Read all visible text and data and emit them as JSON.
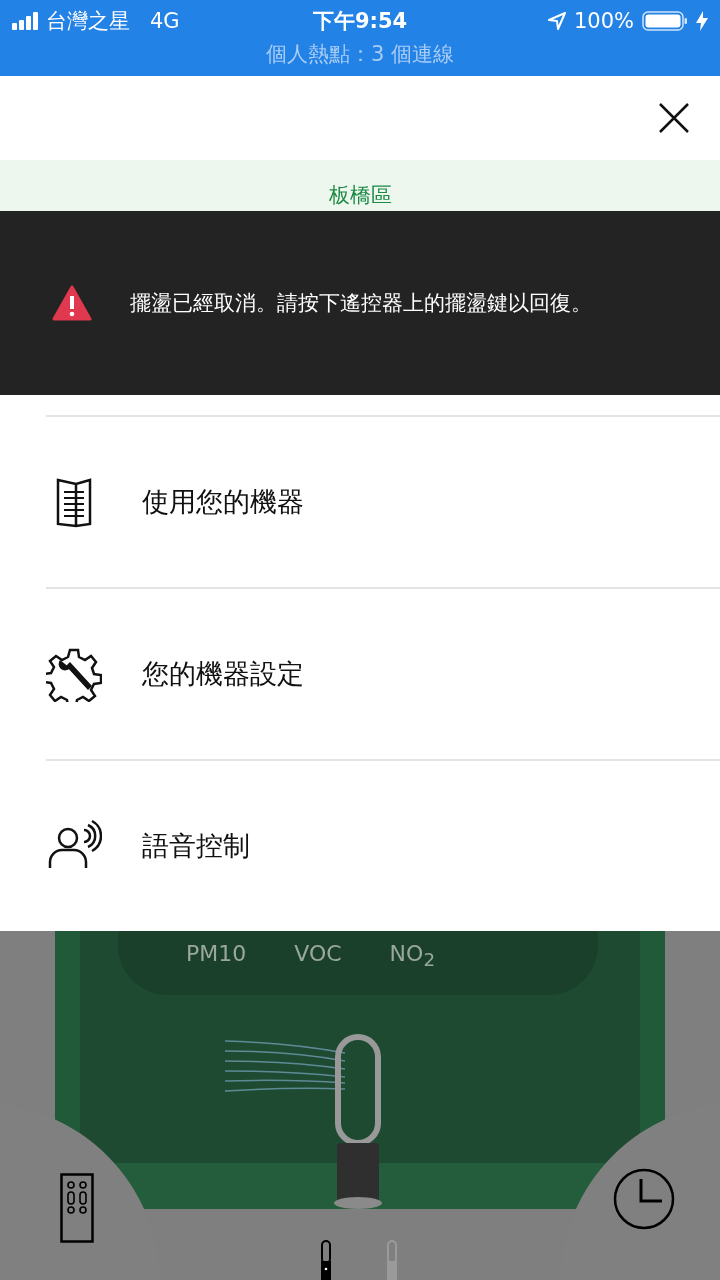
{
  "status_bar": {
    "carrier": "台灣之星",
    "network": "4G",
    "time": "下午9:54",
    "battery": "100%",
    "hotspot": "個人熱點：3 個連線"
  },
  "header": {
    "location": "板橋區"
  },
  "alert": {
    "message": "擺盪已經取消。請按下遙控器上的擺盪鍵以回復。"
  },
  "menu": [
    {
      "kind": "manual",
      "label": "使用您的機器"
    },
    {
      "kind": "settings",
      "label": "您的機器設定"
    },
    {
      "kind": "voice",
      "label": "語音控制"
    }
  ],
  "dashboard": {
    "metrics": [
      "PM10",
      "VOC",
      "NO$_{2}$"
    ],
    "devices": [
      {
        "selected": true
      },
      {
        "selected": false
      }
    ]
  }
}
